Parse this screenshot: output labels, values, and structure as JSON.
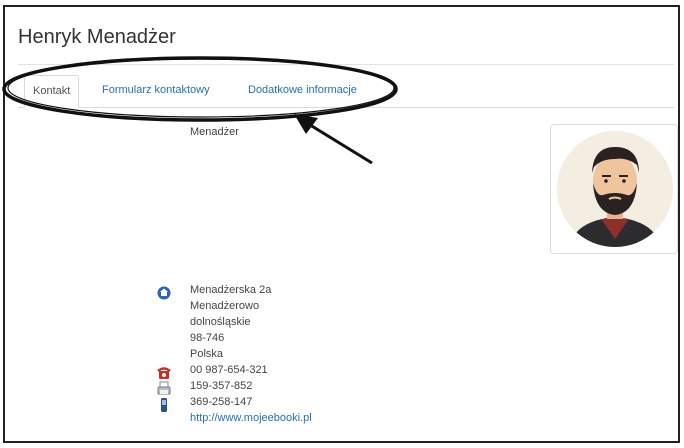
{
  "contact": {
    "name": "Henryk Menadżer",
    "position": "Menadżer"
  },
  "tabs": [
    {
      "label": "Kontakt",
      "active": true
    },
    {
      "label": "Formularz kontaktowy",
      "active": false
    },
    {
      "label": "Dodatkowe informacje",
      "active": false
    }
  ],
  "address": {
    "street": "Menadżerska 2a",
    "city": "Menadżerowo",
    "region": "dolnośląskie",
    "postcode": "98-746",
    "country": "Polska"
  },
  "phone": "00 987-654-321",
  "fax": "159-357-852",
  "mobile": "369-258-147",
  "website": "http://www.mojeebooki.pl",
  "icons": {
    "address": "address-icon",
    "phone": "phone-icon",
    "fax": "fax-icon",
    "mobile": "mobile-icon"
  },
  "colors": {
    "link": "#2a6fb5",
    "annotation": "#111111"
  }
}
